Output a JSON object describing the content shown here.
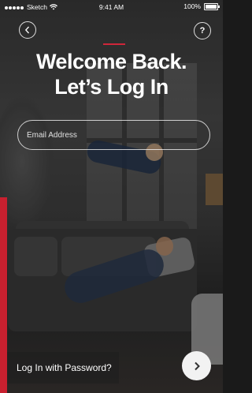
{
  "status_bar": {
    "carrier": "Sketch",
    "time": "9:41 AM",
    "battery": "100%"
  },
  "header": {
    "back_icon": "chevron-left-icon",
    "help_icon": "question-icon",
    "help_glyph": "?"
  },
  "title": {
    "line1": "Welcome Back.",
    "line2": "Let’s Log In"
  },
  "form": {
    "email_placeholder": "Email Address"
  },
  "footer": {
    "password_login_label": "Log In with Password?",
    "next_icon": "chevron-right-icon"
  },
  "colors": {
    "accent": "#c8202f",
    "text": "#ffffff"
  }
}
